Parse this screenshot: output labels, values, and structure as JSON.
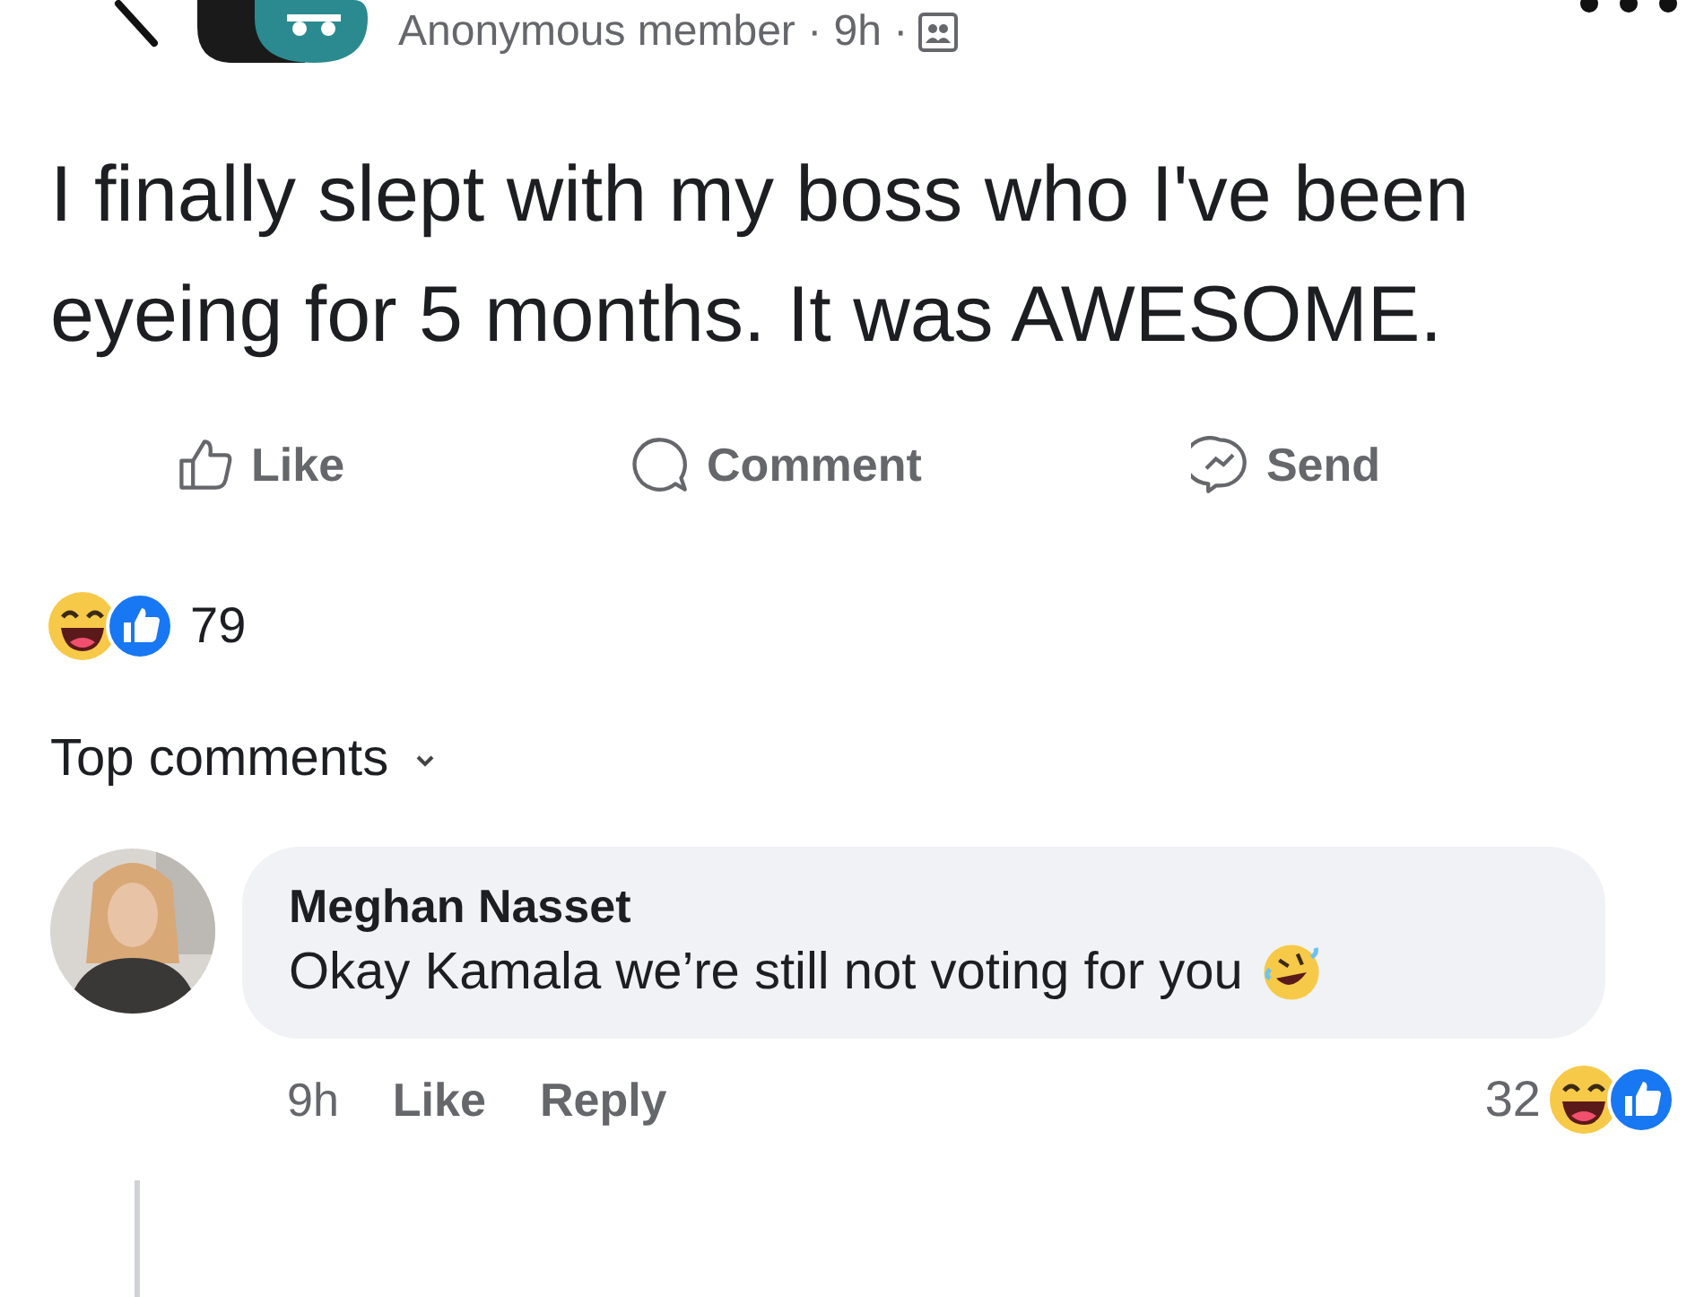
{
  "header": {
    "meta": "Anonymous member · 9h ·"
  },
  "post": {
    "text": "I finally slept with my boss who I've been eyeing for 5 months. It was AWESOME."
  },
  "actions": [
    {
      "kind": "like",
      "label": "Like"
    },
    {
      "kind": "comment",
      "label": "Comment"
    },
    {
      "kind": "send",
      "label": "Send"
    }
  ],
  "reactions": {
    "count": "79"
  },
  "comments_header": {
    "label": "Top comments"
  },
  "comments": [
    {
      "author": "Meghan Nasset",
      "text": "Okay Kamala we’re still not voting for you",
      "time": "9h",
      "actions": [
        "Like",
        "Reply"
      ],
      "reaction_count": "32"
    }
  ]
}
